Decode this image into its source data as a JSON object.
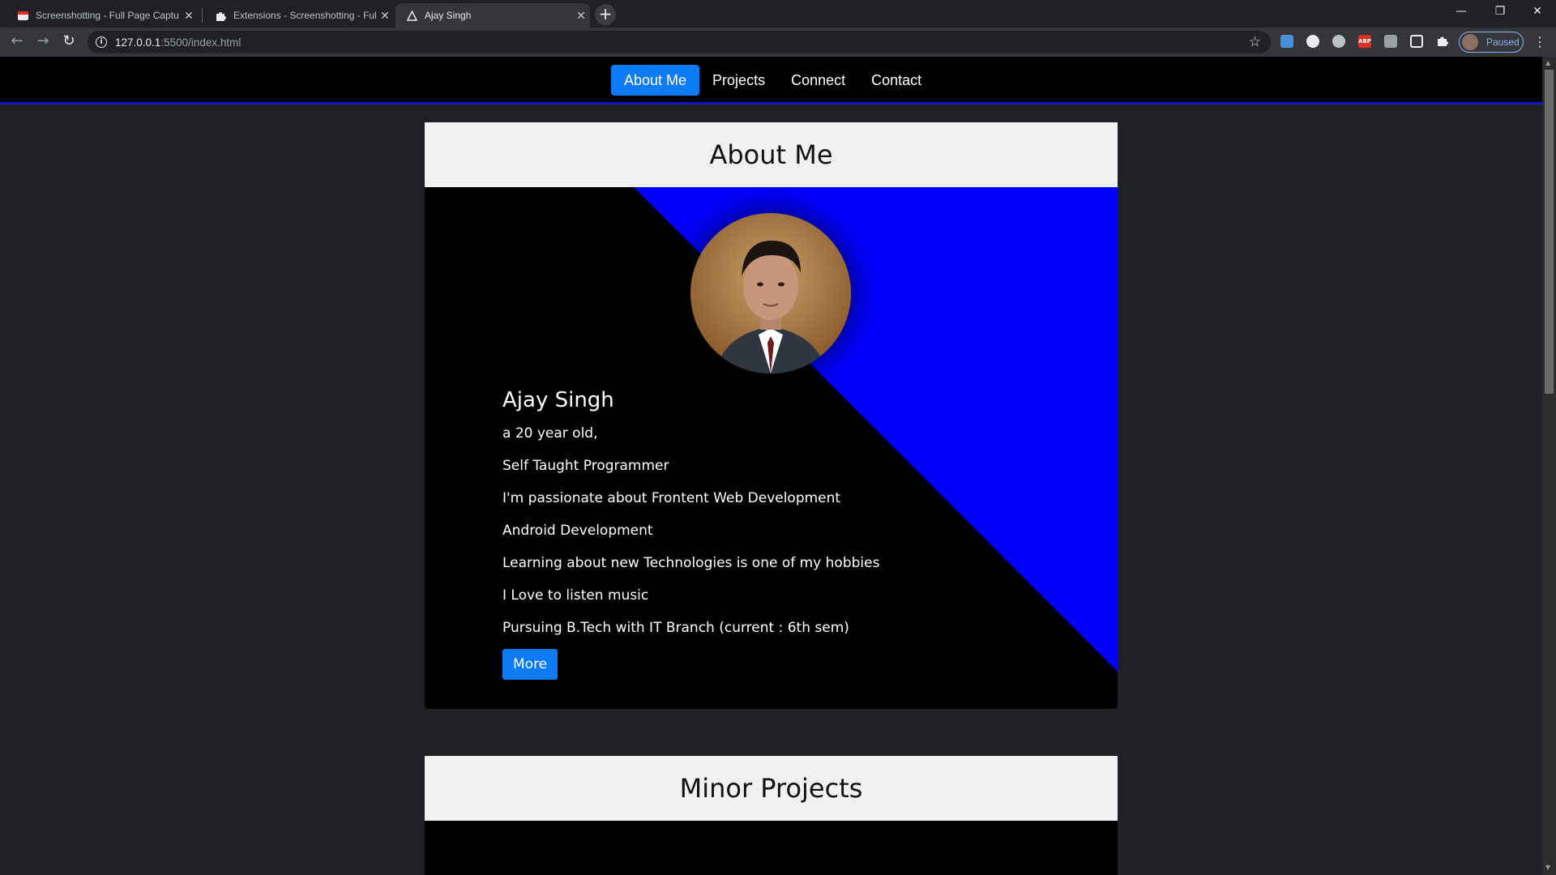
{
  "browser": {
    "tabs": [
      {
        "title": "Screenshotting - Full Page Captu",
        "icon": "screenshot-app-icon"
      },
      {
        "title": "Extensions - Screenshotting - Ful",
        "icon": "puzzle-icon"
      },
      {
        "title": "Ajay Singh",
        "icon": "site-favicon",
        "active": true
      }
    ],
    "url_host": "127.0.0.1",
    "url_rest": ":5500/index.html",
    "profile_status": "Paused"
  },
  "site": {
    "nav": [
      {
        "label": "About Me",
        "active": true
      },
      {
        "label": "Projects"
      },
      {
        "label": "Connect"
      },
      {
        "label": "Contact"
      }
    ],
    "about": {
      "heading": "About Me",
      "name": "Ajay Singh",
      "lines": [
        "a 20 year old,",
        "Self Taught Programmer",
        "I'm passionate about Frontent Web Development",
        "Android Development",
        "Learning about new Technologies is one of my hobbies",
        "I Love to listen music",
        "Pursuing B.Tech with IT Branch (current : 6th sem)"
      ],
      "button": "More"
    },
    "projects": {
      "heading": "Minor Projects"
    }
  },
  "colors": {
    "accent_blue": "#0d7bf5",
    "diagonal_blue": "#0000ff",
    "nav_border": "#0a1ac8"
  }
}
